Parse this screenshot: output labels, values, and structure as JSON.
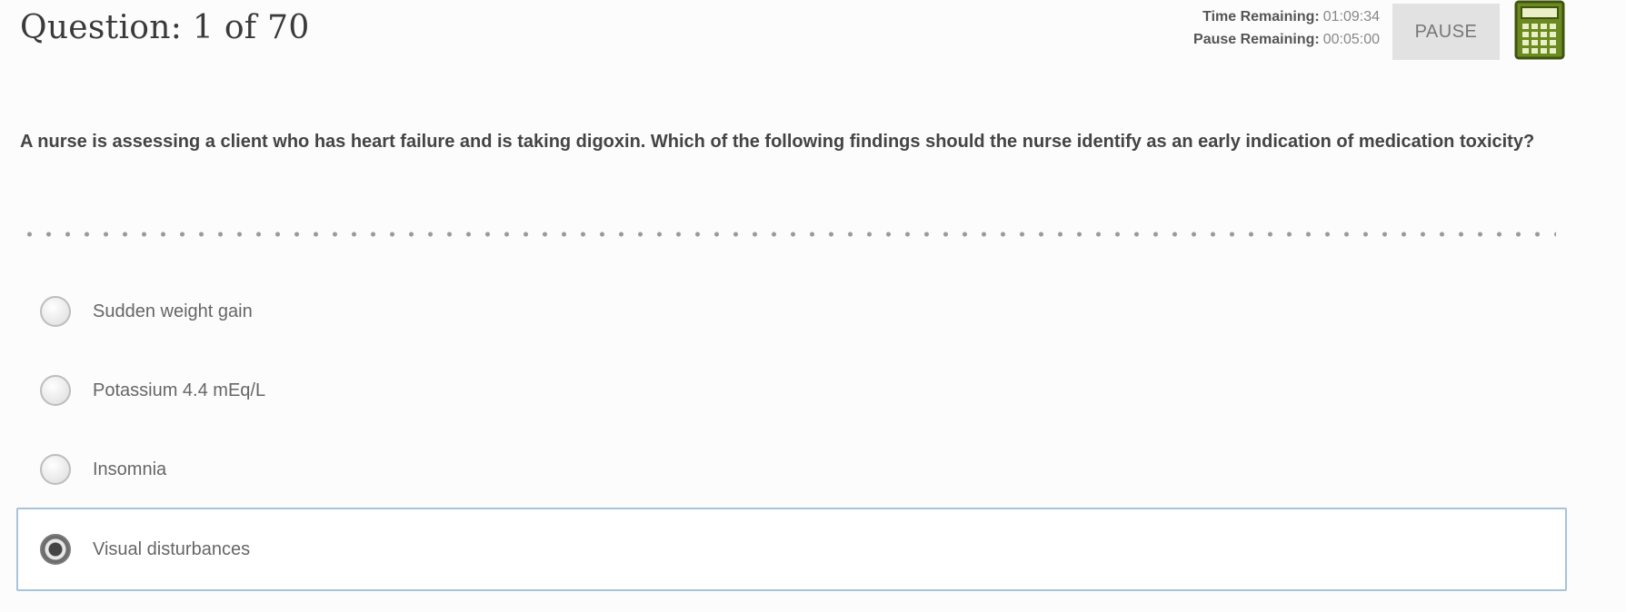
{
  "header": {
    "question_counter": "Question: 1 of 70",
    "time_remaining_label": "Time Remaining:",
    "time_remaining_value": "01:09:34",
    "pause_remaining_label": "Pause Remaining:",
    "pause_remaining_value": "00:05:00",
    "pause_button_label": "PAUSE",
    "calculator_icon": "calculator-icon"
  },
  "question": {
    "text": "A nurse is assessing a client who has heart failure and is taking digoxin. Which of the following findings should the nurse identify as an early indication of medication toxicity?"
  },
  "options": [
    {
      "label": "Sudden weight gain",
      "selected": false
    },
    {
      "label": "Potassium 4.4 mEq/L",
      "selected": false
    },
    {
      "label": "Insomnia",
      "selected": false
    },
    {
      "label": "Visual disturbances",
      "selected": true
    }
  ],
  "colors": {
    "selected_border": "#a6c4da",
    "calculator_green": "#5e7a1a"
  }
}
